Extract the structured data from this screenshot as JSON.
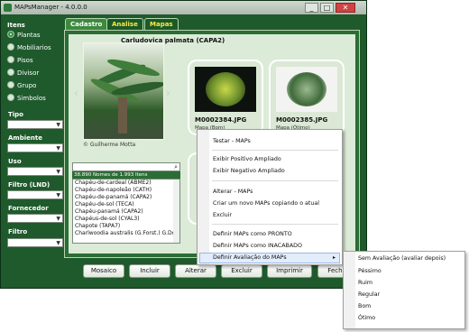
{
  "window": {
    "title": "MAPsManager - 4.0.0.0",
    "controls": [
      "_",
      "□",
      "✕"
    ]
  },
  "sidebar": {
    "itens_label": "Itens",
    "radios": [
      {
        "label": "Plantas",
        "selected": true
      },
      {
        "label": "Mobiliarios",
        "selected": false
      },
      {
        "label": "Pisos",
        "selected": false
      },
      {
        "label": "Divisor",
        "selected": false
      },
      {
        "label": "Grupo",
        "selected": false
      },
      {
        "label": "Simbolos",
        "selected": false
      }
    ],
    "filters": [
      "Tipo",
      "Ambiente",
      "Uso",
      "Filtro (LND)",
      "Fornecedor",
      "Filtro"
    ]
  },
  "tabs": [
    {
      "label": "Cadastro",
      "active": true
    },
    {
      "label": "Analise",
      "active": false
    },
    {
      "label": "Mapas",
      "active": false
    }
  ],
  "plant": {
    "title": "Carludovica palmata (CAPA2)",
    "photo_credit": "© Guilherme Motta"
  },
  "cards": [
    {
      "filename": "M0002384.JPG",
      "subtitle": "Mapa (Bom)"
    },
    {
      "filename": "M0002385.JPG",
      "subtitle": "Mapa (Ótimo)"
    }
  ],
  "list": {
    "count_text": "38.890 Nomes de 1.993 Itens",
    "rows": [
      "Chapéu-de-cardeal (ABME2)",
      "Chapéu-de-napoleão (CATH)",
      "Chapéu-de-panamá (CAPA2)",
      "Chapéu-de-sol (TECA)",
      "Chapéu-panamá (CAPA2)",
      "Chapéus-de-sol (CYAL3)",
      "Chapote (TAPA7)",
      "Charlwoodia australis (G.Forst.) G.Don"
    ]
  },
  "buttons": [
    "Mosaico",
    "Incluir",
    "Alterar",
    "Excluir",
    "Imprimir",
    "Fechar"
  ],
  "context_menu": {
    "items": [
      "Testar - MAPs",
      "Exibir Positivo Ampliado",
      "Exibir Negativo Ampliado",
      "Alterar - MAPs",
      "Criar um novo MAPs copiando o atual",
      "Excluir",
      "Definir MAPs como PRONTO",
      "Definir MAPs como INACABADO",
      "Definir Avaliação do MAPs"
    ],
    "submenu_arrow": "▸"
  },
  "submenu": {
    "items": [
      "Sem Avaliação (avaliar depois)",
      "Péssimo",
      "Ruim",
      "Regular",
      "Bom",
      "Ótimo"
    ]
  },
  "colors": {
    "frame": "#1f5a2c",
    "panel": "#2b6d34",
    "tab_text": "#ffe84a",
    "highlight": "#e2ecfb"
  },
  "icons": [
    "app-icon",
    "search-icon",
    "chevron-left-icon",
    "chevron-right-icon",
    "submenu-arrow-icon"
  ]
}
